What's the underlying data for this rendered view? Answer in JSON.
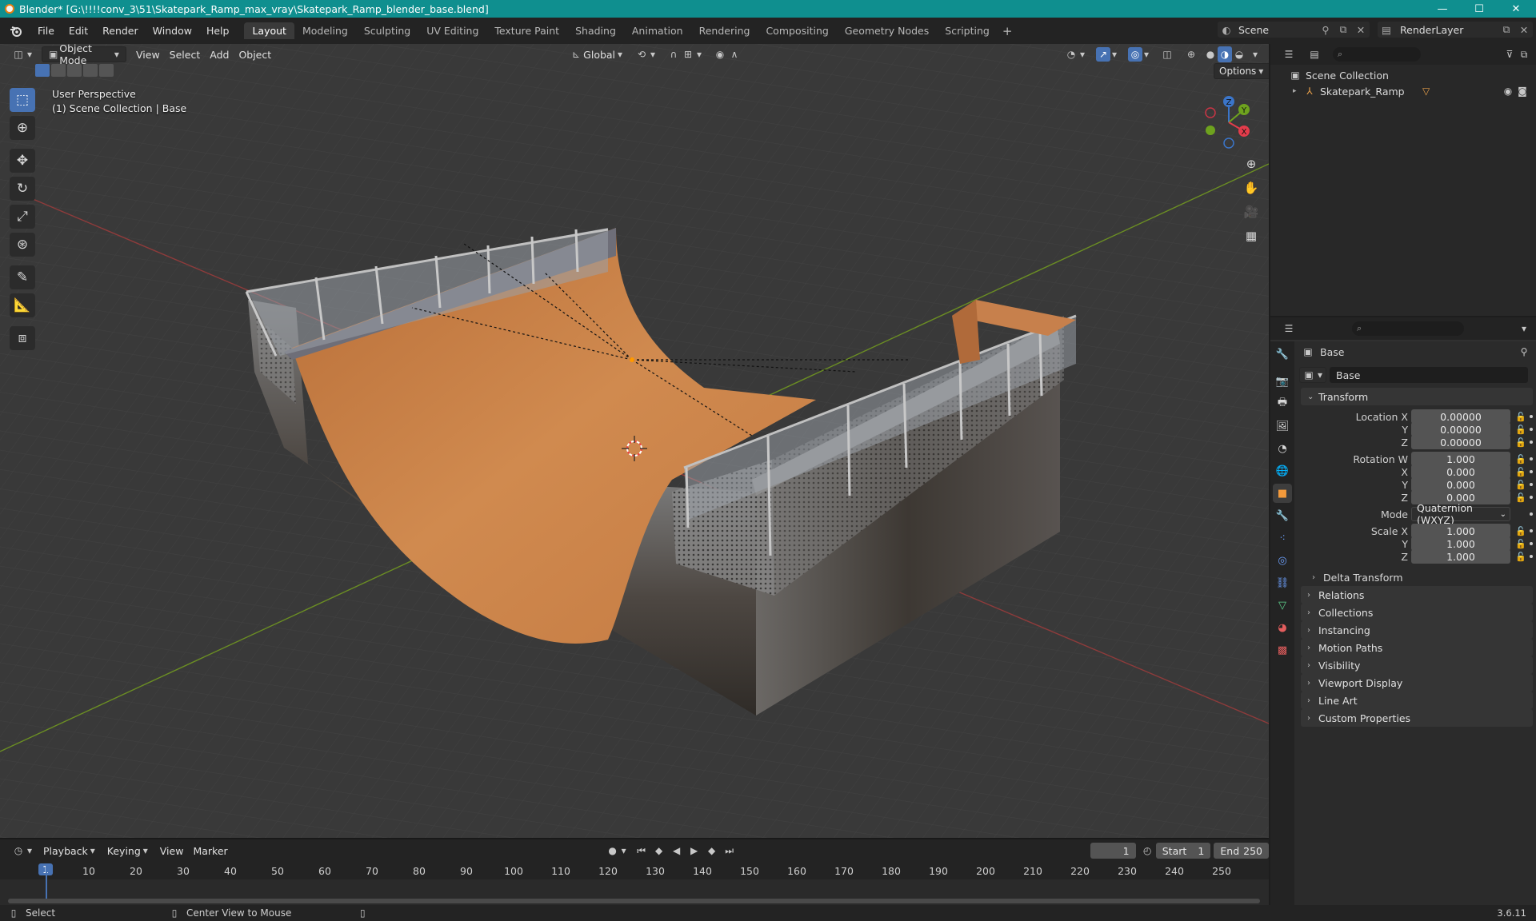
{
  "window": {
    "title": "Blender* [G:\\!!!!conv_3\\51\\Skatepark_Ramp_max_vray\\Skatepark_Ramp_blender_base.blend]",
    "minimize": "—",
    "maximize": "☐",
    "close": "✕"
  },
  "menu": {
    "items": [
      "File",
      "Edit",
      "Render",
      "Window",
      "Help"
    ],
    "workspaces": [
      "Layout",
      "Modeling",
      "Sculpting",
      "UV Editing",
      "Texture Paint",
      "Shading",
      "Animation",
      "Rendering",
      "Compositing",
      "Geometry Nodes",
      "Scripting"
    ],
    "active_workspace": "Layout",
    "add_tab": "+",
    "scene": "Scene",
    "render_layer": "RenderLayer"
  },
  "viewport": {
    "mode": "Object Mode",
    "menus": [
      "View",
      "Select",
      "Add",
      "Object"
    ],
    "orientation": "Global",
    "options": "Options",
    "perspective_label": "User Perspective",
    "collection_label": "(1) Scene Collection | Base",
    "gizmo": {
      "x": "X",
      "y": "Y",
      "z": "Z"
    }
  },
  "timeline": {
    "menus": [
      "Playback",
      "Keying",
      "View",
      "Marker"
    ],
    "current_frame": "1",
    "start_label": "Start",
    "start": "1",
    "end_label": "End",
    "end": "250",
    "ruler": [
      "1",
      "10",
      "20",
      "30",
      "40",
      "50",
      "60",
      "70",
      "80",
      "90",
      "100",
      "110",
      "120",
      "130",
      "140",
      "150",
      "160",
      "170",
      "180",
      "190",
      "200",
      "210",
      "220",
      "230",
      "240",
      "250"
    ]
  },
  "statusbar": {
    "left": "Select",
    "middle": "Center View to Mouse",
    "version": "3.6.11"
  },
  "outliner": {
    "root": "Scene Collection",
    "items": [
      {
        "name": "Skatepark_Ramp"
      }
    ]
  },
  "properties": {
    "object_name": "Base",
    "data_name": "Base",
    "transform_label": "Transform",
    "location": {
      "label": "Location X",
      "x": "0.00000",
      "y": "0.00000",
      "z": "0.00000"
    },
    "rotation": {
      "label": "Rotation W",
      "w": "1.000",
      "x": "0.000",
      "y": "0.000",
      "z": "0.000"
    },
    "mode_label": "Mode",
    "mode_value": "Quaternion (WXYZ)",
    "scale": {
      "label": "Scale X",
      "x": "1.000",
      "y": "1.000",
      "z": "1.000"
    },
    "axis": {
      "x": "X",
      "y": "Y",
      "z": "Z"
    },
    "delta_transform": "Delta Transform",
    "panels": [
      "Relations",
      "Collections",
      "Instancing",
      "Motion Paths",
      "Visibility",
      "Viewport Display",
      "Line Art",
      "Custom Properties"
    ]
  },
  "colors": {
    "accent": "#4772b3",
    "titlebar": "#0f8f8f",
    "frame_marker": "#4772b3",
    "ramp_wood": "#c87a3f"
  }
}
